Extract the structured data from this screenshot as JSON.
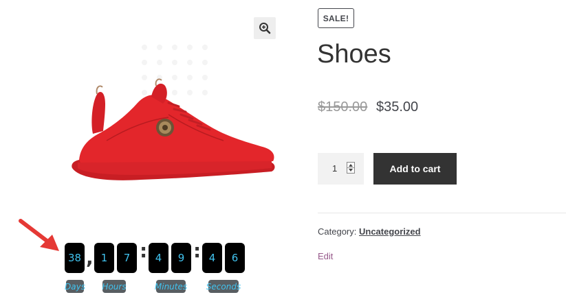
{
  "product": {
    "sale_badge": "SALE!",
    "title": "Shoes",
    "old_price": "$150.00",
    "new_price": "$35.00",
    "quantity": "1",
    "add_to_cart_label": "Add to cart",
    "category_label": "Category:",
    "category_value": "Uncategorized",
    "edit_label": "Edit"
  },
  "countdown": {
    "days": "38",
    "hours": [
      "1",
      "7"
    ],
    "minutes": [
      "4",
      "9"
    ],
    "seconds": [
      "4",
      "6"
    ],
    "separators": [
      ",",
      ":",
      ":"
    ],
    "labels": {
      "days": "Days",
      "hours": "Hours",
      "minutes": "Minutes",
      "seconds": "Seconds"
    }
  },
  "icons": {
    "zoom": "zoom-in-icon",
    "arrow": "red-arrow-icon"
  },
  "colors": {
    "countdown_digit": "#41c3ef",
    "countdown_box": "#000000",
    "cart_button": "#333333",
    "edit_link": "#96588a",
    "shoe": "#e3262b"
  }
}
